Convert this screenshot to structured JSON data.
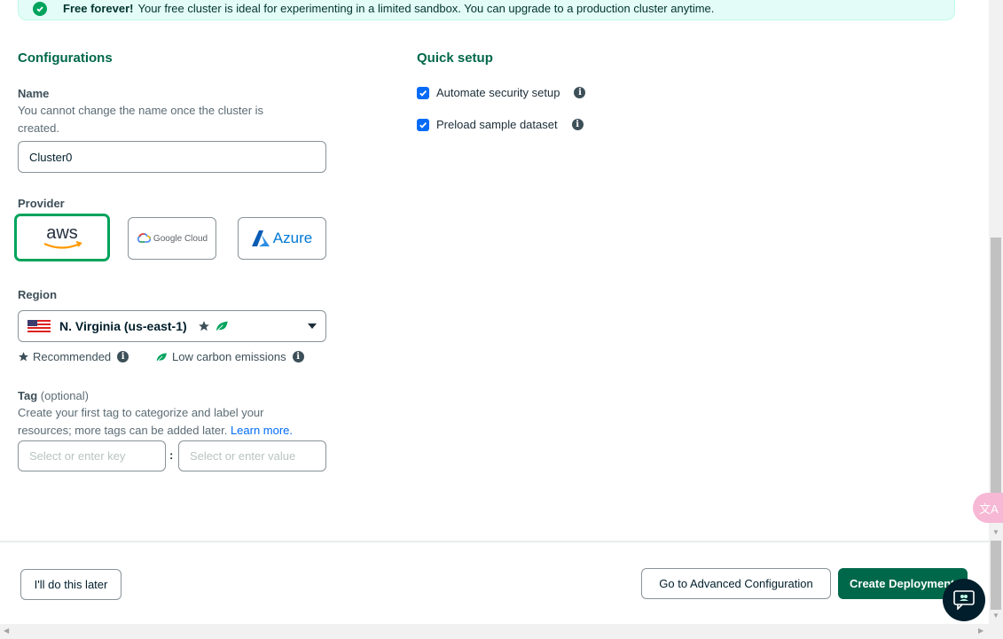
{
  "banner": {
    "strong": "Free forever!",
    "text": "Your free cluster is ideal for experimenting in a limited sandbox. You can upgrade to a production cluster anytime."
  },
  "configurations": {
    "title": "Configurations",
    "name": {
      "label": "Name",
      "description": "You cannot change the name once the cluster is created.",
      "value": "Cluster0"
    },
    "provider": {
      "label": "Provider",
      "options": [
        {
          "id": "aws",
          "label": "aws",
          "selected": true
        },
        {
          "id": "gcp",
          "label": "Google Cloud",
          "selected": false
        },
        {
          "id": "azure",
          "label": "Azure",
          "selected": false
        }
      ]
    },
    "region": {
      "label": "Region",
      "value": "N. Virginia (us-east-1)",
      "legend_recommended": "Recommended",
      "legend_low_carbon": "Low carbon emissions"
    },
    "tag": {
      "label": "Tag",
      "optional": "(optional)",
      "description": "Create your first tag to categorize and label your resources; more tags can be added later.",
      "learn_more": "Learn more.",
      "key_placeholder": "Select or enter key",
      "separator": ":",
      "value_placeholder": "Select or enter value"
    }
  },
  "quick_setup": {
    "title": "Quick setup",
    "items": [
      {
        "label": "Automate security setup",
        "checked": true
      },
      {
        "label": "Preload sample dataset",
        "checked": true
      }
    ]
  },
  "footer": {
    "later": "I'll do this later",
    "advanced": "Go to Advanced Configuration",
    "create": "Create Deployment"
  },
  "widgets": {
    "translate_glyph": "文A"
  },
  "colors": {
    "brand_green": "#00684a",
    "accent_green": "#00a35c",
    "link_blue": "#016bf8"
  }
}
